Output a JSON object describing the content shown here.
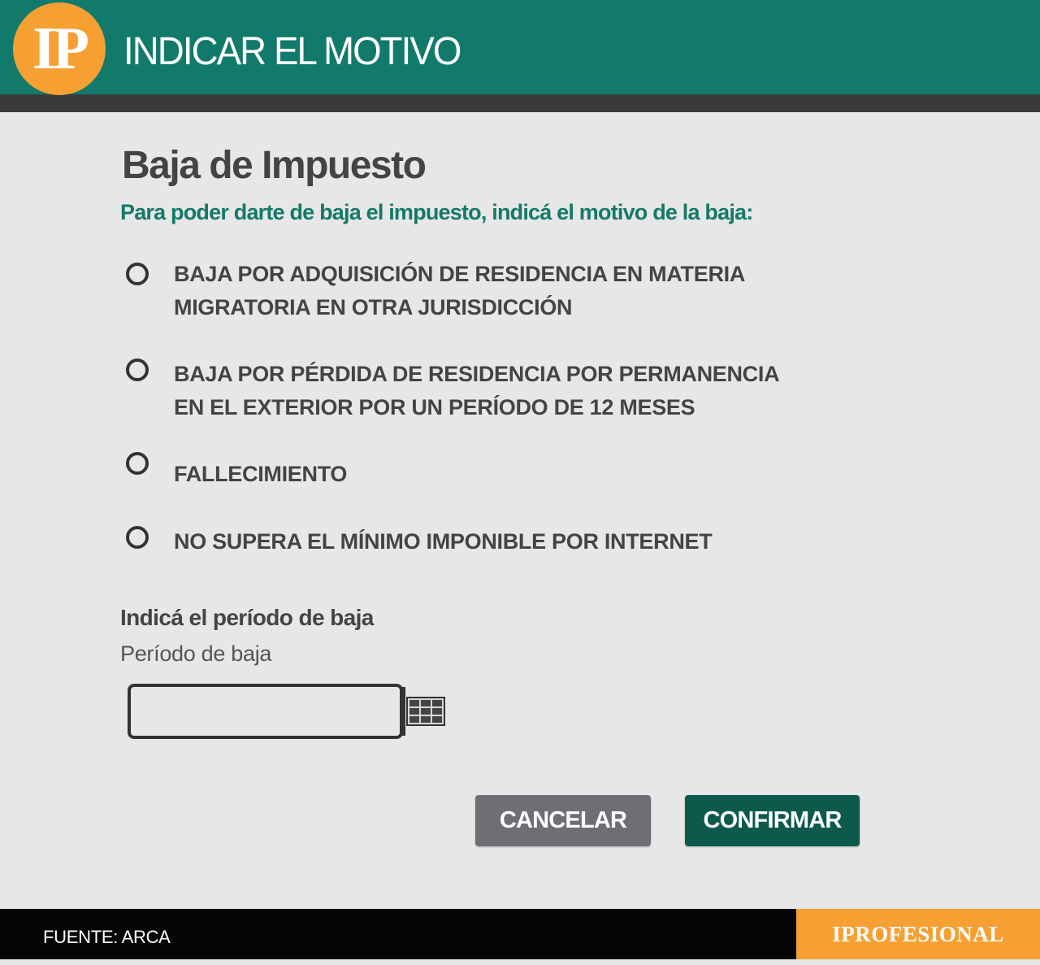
{
  "header": {
    "logo_text": "IP",
    "title": "INDICAR EL MOTIVO"
  },
  "form": {
    "title": "Baja de Impuesto",
    "subtitle": "Para poder darte de baja el impuesto, indicá el motivo de la baja:",
    "options": [
      {
        "label_line1": "BAJA POR ADQUISICIÓN DE RESIDENCIA EN MATERIA",
        "label_line2": "MIGRATORIA EN OTRA JURISDICCIÓN",
        "selected": false
      },
      {
        "label_line1": "BAJA POR PÉRDIDA DE RESIDENCIA POR PERMANENCIA",
        "label_line2": "EN EL EXTERIOR POR UN PERÍODO DE 12 MESES",
        "selected": false
      },
      {
        "label_line1": "FALLECIMIENTO",
        "label_line2": "",
        "selected": false
      },
      {
        "label_line1": "NO SUPERA EL MÍNIMO IMPONIBLE POR INTERNET",
        "label_line2": "",
        "selected": false
      }
    ],
    "period_section_label": "Indicá el período de baja",
    "period_field_label": "Período de baja",
    "period_value": "",
    "cancel_label": "CANCELAR",
    "confirm_label": "CONFIRMAR"
  },
  "footer": {
    "source": "FUENTE: ARCA",
    "brand": "IPROFESIONAL"
  },
  "colors": {
    "header_bg": "#127a6b",
    "accent_orange": "#f6a033",
    "subtitle_green": "#137a68",
    "confirm_bg": "#0d5a4c",
    "cancel_bg": "#6e6e74"
  },
  "icons": {
    "calendar": "calendar-icon"
  }
}
